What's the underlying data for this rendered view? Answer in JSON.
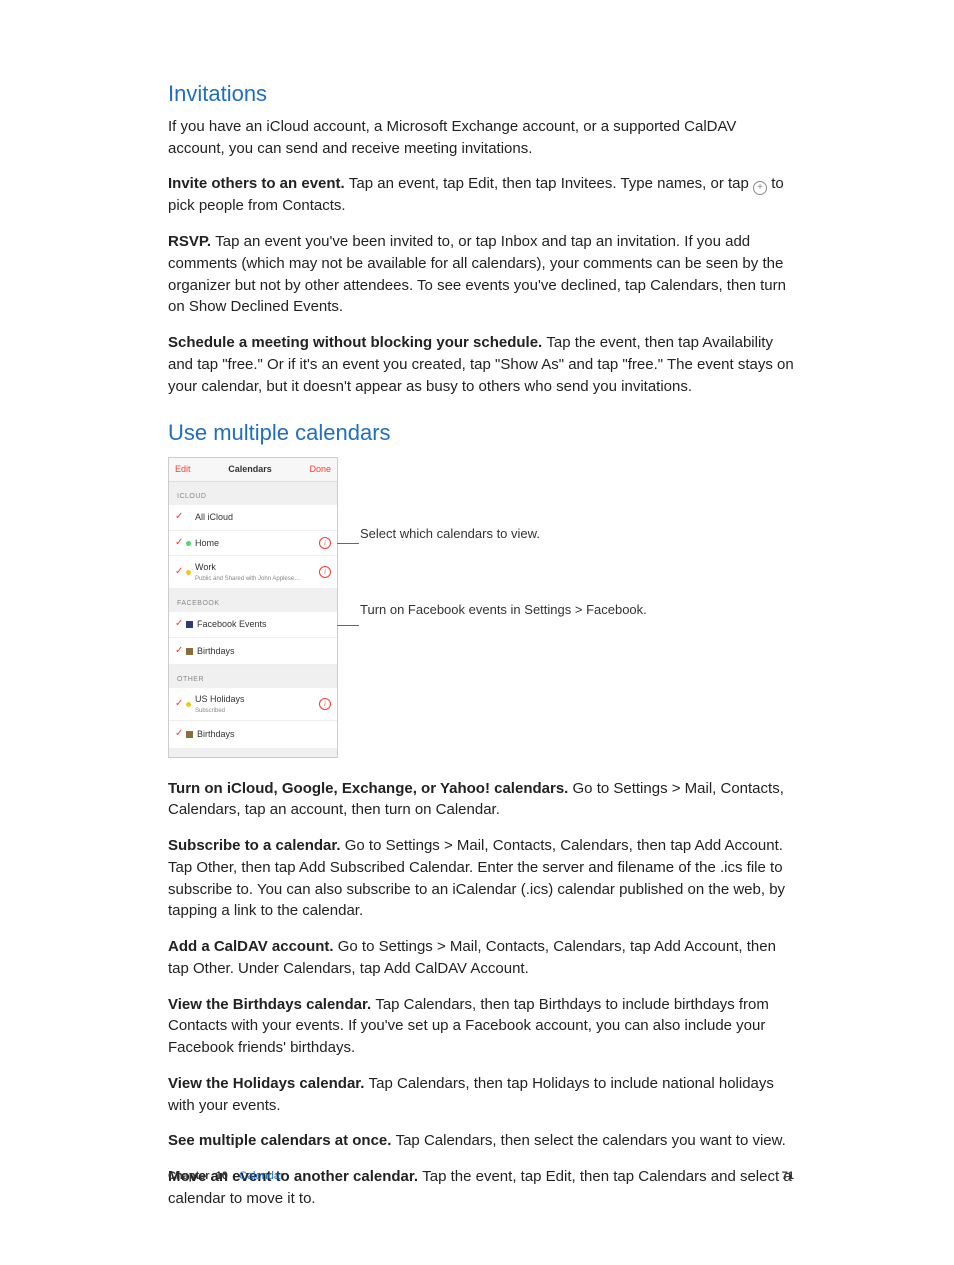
{
  "sections": {
    "invitations": {
      "heading": "Invitations",
      "intro": "If you have an iCloud account, a Microsoft Exchange account, or a supported CalDAV account, you can send and receive meeting invitations.",
      "invite_bold": "Invite others to an event. ",
      "invite_text_a": "Tap an event, tap Edit, then tap Invitees. Type names, or tap ",
      "invite_text_b": " to pick people from Contacts.",
      "rsvp_bold": "RSVP. ",
      "rsvp_text": "Tap an event you've been invited to, or tap Inbox and tap an invitation. If you add comments (which may not be available for all calendars), your comments can be seen by the organizer but not by other attendees. To see events you've declined, tap Calendars, then turn on Show Declined Events.",
      "schedule_bold": "Schedule a meeting without blocking your schedule. ",
      "schedule_text": "Tap the event, then tap Availability and tap \"free.\" Or if it's an event you created, tap \"Show As\" and tap \"free.\" The event stays on your calendar, but it doesn't appear as busy to others who send you invitations."
    },
    "multiple": {
      "heading": "Use multiple calendars",
      "callout1": "Select which calendars to view.",
      "callout2": "Turn on Facebook events in Settings > Facebook.",
      "turnon_bold": "Turn on iCloud, Google, Exchange, or Yahoo! calendars. ",
      "turnon_text": "Go to Settings > Mail, Contacts, Calendars, tap an account, then turn on Calendar.",
      "subscribe_bold": "Subscribe to a calendar. ",
      "subscribe_text": "Go to Settings > Mail, Contacts, Calendars, then tap Add Account. Tap Other, then tap Add Subscribed Calendar. Enter the server and filename of the .ics file to subscribe to. You can also subscribe to an iCalendar (.ics) calendar published on the web, by tapping a link to the calendar.",
      "caldav_bold": "Add a CalDAV account. ",
      "caldav_text": "Go to Settings > Mail, Contacts, Calendars, tap Add Account, then tap Other. Under Calendars, tap Add CalDAV Account.",
      "birthdays_bold": "View the Birthdays calendar. ",
      "birthdays_text": "Tap Calendars, then tap Birthdays to include birthdays from Contacts with your events. If you've set up a Facebook account, you can also include your Facebook friends' birthdays.",
      "holidays_bold": "View the Holidays calendar. ",
      "holidays_text": "Tap Calendars, then tap Holidays to include national holidays with your events.",
      "seemulti_bold": "See multiple calendars at once. ",
      "seemulti_text": "Tap Calendars, then select the calendars you want to view.",
      "move_bold": "Move an event to another calendar. ",
      "move_text": "Tap the event, tap Edit, then tap Calendars and select a calendar to move it to."
    }
  },
  "calmock": {
    "edit": "Edit",
    "title": "Calendars",
    "done": "Done",
    "groups": {
      "icloud": "ICLOUD",
      "facebook": "FACEBOOK",
      "other": "OTHER"
    },
    "rows": {
      "all_icloud": "All iCloud",
      "home": "Home",
      "work": "Work",
      "work_sub": "Public and Shared with John Applese…",
      "fb_events": "Facebook Events",
      "fb_birthdays": "Birthdays",
      "us_holidays": "US Holidays",
      "us_holidays_sub": "Subscribed",
      "other_birthdays": "Birthdays"
    }
  },
  "footer": {
    "chapter_label": "Chapter",
    "chapter_num": "10",
    "chapter_name": "Calendar",
    "page": "71"
  }
}
